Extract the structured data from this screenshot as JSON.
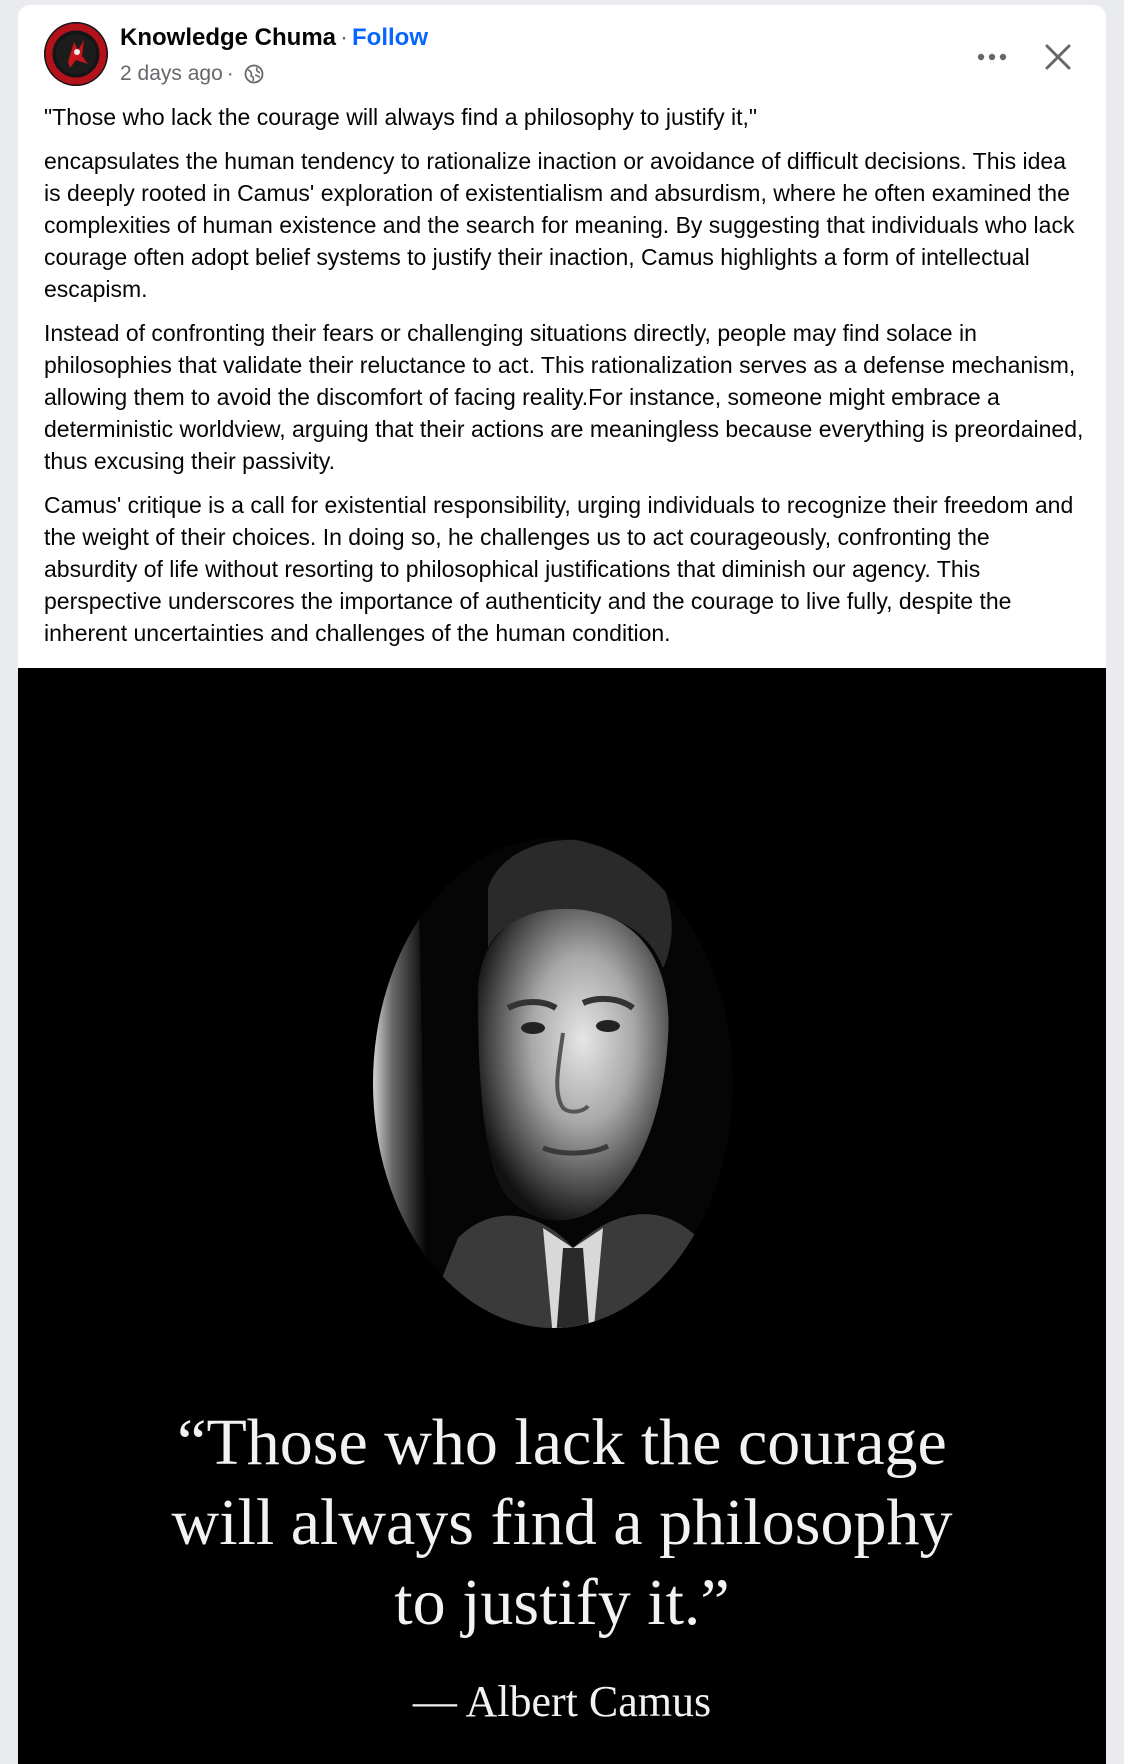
{
  "post": {
    "author": "Knowledge Chuma",
    "separator": "·",
    "follow_label": "Follow",
    "timestamp": "2 days ago",
    "meta_separator": "·",
    "audience_icon": "globe-icon",
    "more_icon": "more-options-icon",
    "close_icon": "close-icon",
    "paragraphs": [
      "\"Those who lack the courage will always find a philosophy to justify it,\"",
      "encapsulates the human tendency to rationalize inaction or avoidance of difficult decisions. This idea is deeply rooted in Camus' exploration of existentialism and absurdism, where he often examined the complexities of human existence and the search for meaning. By suggesting that individuals who lack courage often adopt belief systems to justify their inaction, Camus highlights a form of intellectual escapism.",
      "Instead of confronting their fears or challenging situations directly, people may find solace in philosophies that validate their reluctance to act. This rationalization serves as a defense mechanism, allowing them to avoid the discomfort of facing reality.For instance, someone might embrace a deterministic worldview, arguing that their actions are meaningless because everything is preordained, thus excusing their passivity.",
      "Camus' critique is a call for existential responsibility, urging individuals to recognize their freedom and the weight of their choices. In doing so, he challenges us to act courageously, confronting the absurdity of life without resorting to philosophical justifications that diminish our agency. This perspective underscores the importance of authenticity and the courage to live fully, despite the inherent uncertainties and challenges of the human condition."
    ]
  },
  "image": {
    "quote_lines": [
      "“Those who lack the courage",
      "will always find a philosophy",
      "to justify it.”"
    ],
    "attribution": "— Albert Camus"
  },
  "colors": {
    "link": "#0866ff",
    "text": "#050505",
    "secondary": "#65676b",
    "image_bg": "#000000"
  }
}
